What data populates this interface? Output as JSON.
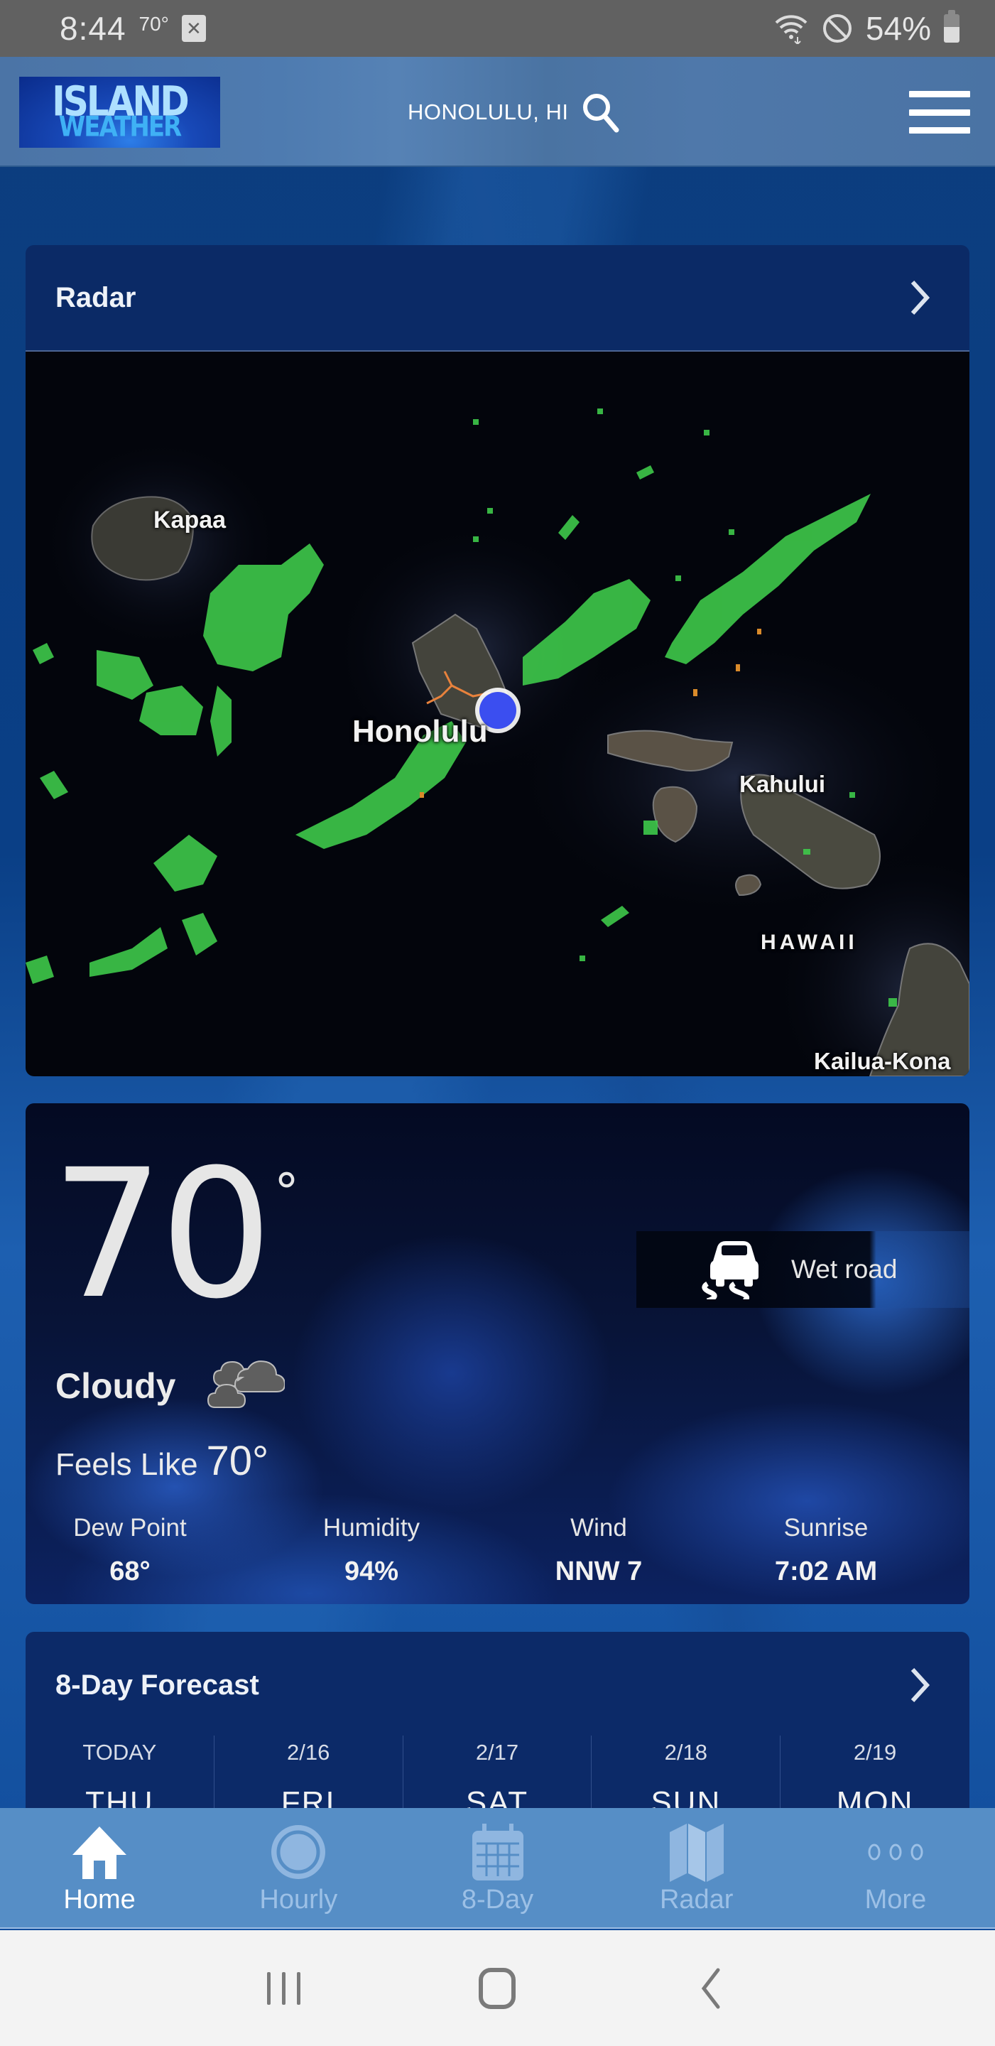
{
  "status_bar": {
    "time": "8:44",
    "temperature": "70°",
    "notification_icon": "close-box-icon",
    "battery_percent": "54%",
    "icons": [
      "wifi-icon",
      "do-not-disturb-icon",
      "battery-icon"
    ]
  },
  "header": {
    "logo_line1": "ISLAND",
    "logo_line2": "WEATHER",
    "location": "HONOLULU, HI",
    "search_icon": "search-icon",
    "menu_icon": "hamburger-menu-icon"
  },
  "radar": {
    "title": "Radar",
    "labels": {
      "kapaa": "Kapaa",
      "honolulu": "Honolulu",
      "kahului": "Kahului",
      "hawaii": "HAWAII",
      "kailua_kona": "Kailua-Kona"
    }
  },
  "current": {
    "temperature": "70",
    "degree_symbol": "°",
    "alert": "Wet road",
    "alert_icon": "slippery-road-icon",
    "condition": "Cloudy",
    "condition_icon": "cloudy-icon",
    "feels_like_label": "Feels Like",
    "feels_like_value": "70°",
    "stats": [
      {
        "label": "Dew Point",
        "value": "68°"
      },
      {
        "label": "Humidity",
        "value": "94%"
      },
      {
        "label": "Wind",
        "value": "NNW 7"
      },
      {
        "label": "Sunrise",
        "value": "7:02 AM"
      }
    ]
  },
  "forecast": {
    "title": "8-Day Forecast",
    "days": [
      {
        "date": "TODAY",
        "day": "THU"
      },
      {
        "date": "2/16",
        "day": "FRI"
      },
      {
        "date": "2/17",
        "day": "SAT"
      },
      {
        "date": "2/18",
        "day": "SUN"
      },
      {
        "date": "2/19",
        "day": "MON"
      }
    ]
  },
  "bottom_nav": {
    "items": [
      {
        "label": "Home",
        "icon": "home-icon",
        "active": true
      },
      {
        "label": "Hourly",
        "icon": "clock-icon",
        "active": false
      },
      {
        "label": "8-Day",
        "icon": "calendar-icon",
        "active": false
      },
      {
        "label": "Radar",
        "icon": "map-icon",
        "active": false
      },
      {
        "label": "More",
        "icon": "more-dots-icon",
        "active": false
      }
    ]
  },
  "system_nav": {
    "buttons": [
      "recent-apps-icon",
      "home-circle-icon",
      "back-icon"
    ]
  },
  "colors": {
    "status_bar": "#616161",
    "header": "#4b74a6",
    "card_header": "#0b2a66",
    "radar_green": "#3ec94a",
    "location_dot": "#3b4ef0",
    "bottom_nav": "#568ec6",
    "nav_inactive": "#9cc0e6",
    "system_nav": "#f3f3f3"
  }
}
